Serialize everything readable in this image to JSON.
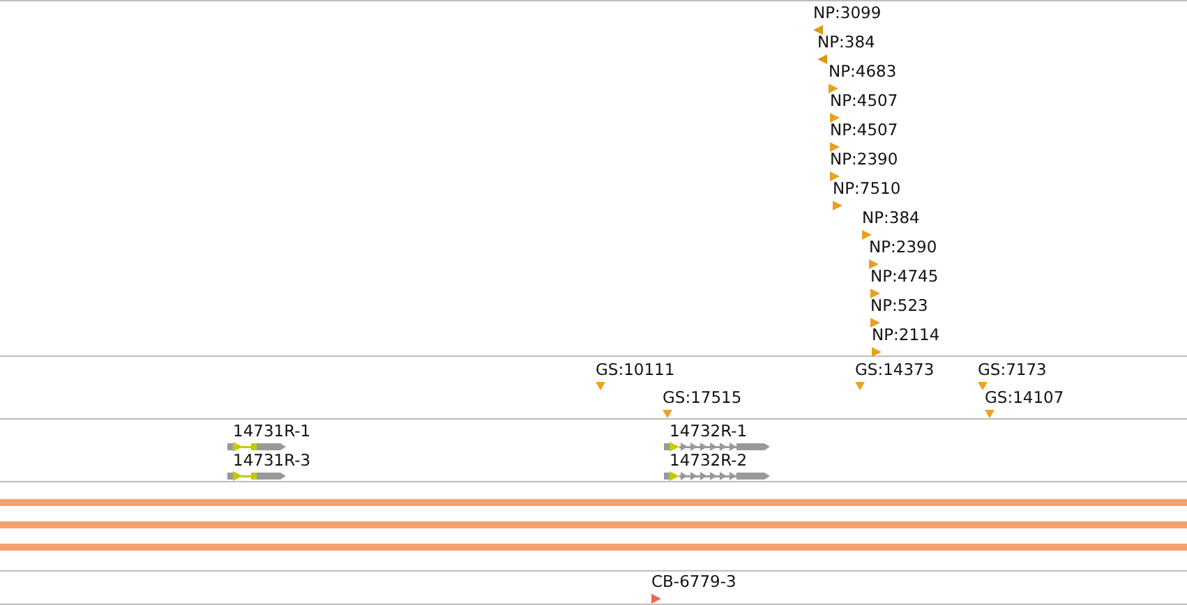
{
  "tracks": [
    {
      "kind": "markers",
      "features": [
        {
          "label": "NP:3099",
          "kind": "left",
          "color": "#d99a16"
        },
        {
          "label": "NP:384",
          "kind": "left",
          "color": "#d99a16"
        },
        {
          "label": "NP:4683",
          "kind": "right",
          "color": "#e8a020"
        },
        {
          "label": "NP:4507",
          "kind": "right",
          "color": "#e8a020"
        },
        {
          "label": "NP:4507",
          "kind": "right",
          "color": "#e8a020"
        },
        {
          "label": "NP:2390",
          "kind": "right",
          "color": "#e8a020"
        },
        {
          "label": "NP:7510",
          "kind": "right",
          "color": "#e8a020"
        },
        {
          "label": "NP:384",
          "kind": "right",
          "color": "#e8a020"
        },
        {
          "label": "NP:2390",
          "kind": "right",
          "color": "#e8a020"
        },
        {
          "label": "NP:4745",
          "kind": "right",
          "color": "#e8a020"
        },
        {
          "label": "NP:523",
          "kind": "right",
          "color": "#e8a020"
        },
        {
          "label": "NP:2114",
          "kind": "right",
          "color": "#e8a020"
        }
      ]
    },
    {
      "kind": "markers",
      "features": [
        {
          "label": "GS:10111",
          "kind": "down",
          "color": "#f0a020"
        },
        {
          "label": "GS:17515",
          "kind": "down",
          "color": "#f0a020"
        },
        {
          "label": "GS:14373",
          "kind": "down",
          "color": "#f0a020"
        },
        {
          "label": "GS:7173",
          "kind": "down",
          "color": "#f0a020"
        },
        {
          "label": "GS:14107",
          "kind": "down",
          "color": "#f0a020"
        }
      ]
    },
    {
      "kind": "genes",
      "features": [
        {
          "label": "14731R-1",
          "kind": "compact"
        },
        {
          "label": "14731R-3",
          "kind": "compact"
        },
        {
          "label": "14732R-1",
          "kind": "chevron"
        },
        {
          "label": "14732R-2",
          "kind": "chevron"
        }
      ]
    },
    {
      "kind": "bands"
    },
    {
      "kind": "markers",
      "features": [
        {
          "label": "CB-6779-3",
          "kind": "right",
          "color": "#f06848"
        }
      ]
    }
  ]
}
